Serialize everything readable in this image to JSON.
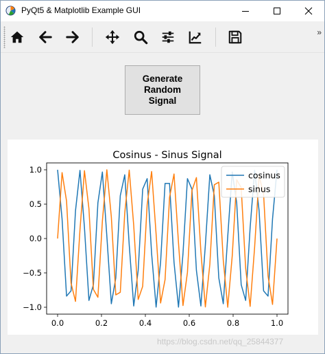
{
  "window": {
    "title": "PyQt5 & Matplotlib Example GUI"
  },
  "icons": {
    "app": "matplotlib-icon",
    "minimize": "minimize-icon",
    "maximize": "maximize-icon",
    "close": "close-icon",
    "home": "home-icon",
    "back": "back-arrow-icon",
    "forward": "forward-arrow-icon",
    "pan": "pan-move-icon",
    "zoom": "zoom-magnifier-icon",
    "configure": "configure-subplots-icon",
    "edit": "edit-axis-icon",
    "save": "save-floppy-icon"
  },
  "toolbar": {
    "overflow": "»"
  },
  "button": {
    "label": "Generate Random Signal"
  },
  "chart_data": {
    "type": "line",
    "title": "Cosinus - Sinus Signal",
    "xlim": [
      -0.05,
      1.05
    ],
    "ylim": [
      -1.1,
      1.1
    ],
    "xticks": [
      "0.0",
      "0.2",
      "0.4",
      "0.6",
      "0.8",
      "1.0"
    ],
    "yticks": [
      "1.0",
      "0.5",
      "0.0",
      "−0.5",
      "−1.0"
    ],
    "frequency": 10,
    "sample_count": 50,
    "series": [
      {
        "name": "cosinus",
        "color": "#1f77b4",
        "function": "cos"
      },
      {
        "name": "sinus",
        "color": "#ff7f0e",
        "function": "sin"
      }
    ],
    "legend": "top-right",
    "grid": false
  },
  "watermark": "https://blog.csdn.net/qq_25844377"
}
